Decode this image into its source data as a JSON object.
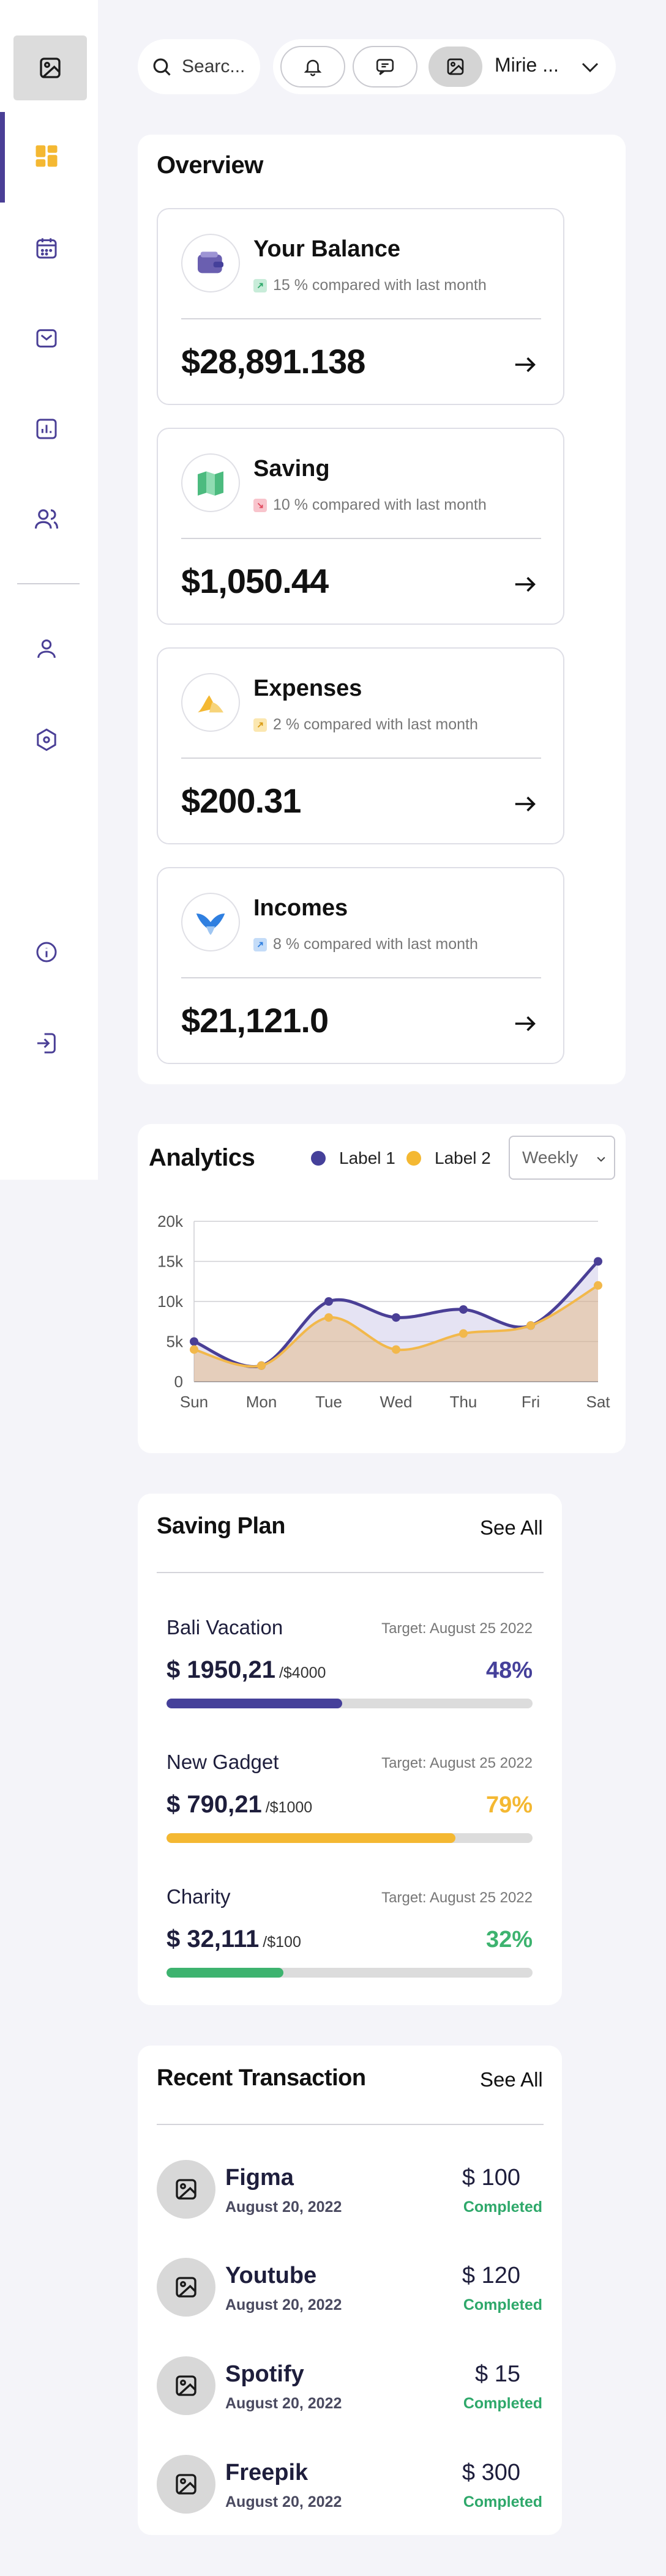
{
  "topbar": {
    "search_placeholder": "Searc...",
    "user_name": "Mirie ..."
  },
  "sidebar": {
    "items": [
      {
        "icon": "dashboard-icon",
        "active": true
      },
      {
        "icon": "calendar-icon"
      },
      {
        "icon": "mail-icon"
      },
      {
        "icon": "chart-icon"
      },
      {
        "icon": "users-icon"
      },
      {
        "icon": "profile-icon"
      },
      {
        "icon": "settings-icon"
      },
      {
        "icon": "info-icon"
      },
      {
        "icon": "logout-icon"
      }
    ]
  },
  "overview": {
    "title": "Overview",
    "cards": [
      {
        "title": "Your Balance",
        "sub": "15 % compared with last month",
        "value": "$28,891.138",
        "accent": "#6a5fb0"
      },
      {
        "title": "Saving",
        "sub": "10 % compared with last month",
        "value": "$1,050.44",
        "accent": "#4cbb7f"
      },
      {
        "title": "Expenses",
        "sub": "2 % compared with last month",
        "value": "$200.31",
        "accent": "#f4b832"
      },
      {
        "title": "Incomes",
        "sub": "8 % compared with last month",
        "value": "$21,121.0",
        "accent": "#2f7fe0"
      }
    ]
  },
  "analytics": {
    "title": "Analytics",
    "legend": [
      "Label 1",
      "Label 2"
    ],
    "period": "Weekly"
  },
  "chart_data": {
    "type": "line",
    "categories": [
      "Sun",
      "Mon",
      "Tue",
      "Wed",
      "Thu",
      "Fri",
      "Sat"
    ],
    "series": [
      {
        "name": "Label 1",
        "values": [
          5000,
          2000,
          10000,
          8000,
          9000,
          7000,
          15000
        ],
        "color": "#4a3f96"
      },
      {
        "name": "Label 2",
        "values": [
          4000,
          2000,
          8000,
          4000,
          6000,
          7000,
          12000
        ],
        "color": "#f2b84b"
      }
    ],
    "ylim": [
      0,
      20000
    ],
    "yticks": [
      "0",
      "5k",
      "10k",
      "15k",
      "20k"
    ],
    "grid": true,
    "legend_position": "top"
  },
  "saving_plan": {
    "title": "Saving Plan",
    "see_all": "See All",
    "items": [
      {
        "name": "Bali Vacation",
        "target": "Target: August 25 2022",
        "amount": "$ 1950,21",
        "of": "/$4000",
        "percent": "48%",
        "progress": 0.48,
        "color": "#45409a"
      },
      {
        "name": "New Gadget",
        "target": "Target: August 25 2022",
        "amount": "$ 790,21",
        "of": "/$1000",
        "percent": "79%",
        "progress": 0.79,
        "color": "#f4b832"
      },
      {
        "name": "Charity",
        "target": "Target: August 25 2022",
        "amount": "$ 32,111",
        "of": "/$100",
        "percent": "32%",
        "progress": 0.32,
        "color": "#3db36f"
      }
    ]
  },
  "transactions": {
    "title": "Recent Transaction",
    "see_all": "See All",
    "items": [
      {
        "name": "Figma",
        "date": "August 20, 2022",
        "amount": "$ 100",
        "status": "Completed"
      },
      {
        "name": "Youtube",
        "date": "August 20, 2022",
        "amount": "$ 120",
        "status": "Completed"
      },
      {
        "name": "Spotify",
        "date": "August 20, 2022",
        "amount": "$ 15",
        "status": "Completed"
      },
      {
        "name": "Freepik",
        "date": "August 20, 2022",
        "amount": "$ 300",
        "status": "Completed"
      }
    ]
  }
}
